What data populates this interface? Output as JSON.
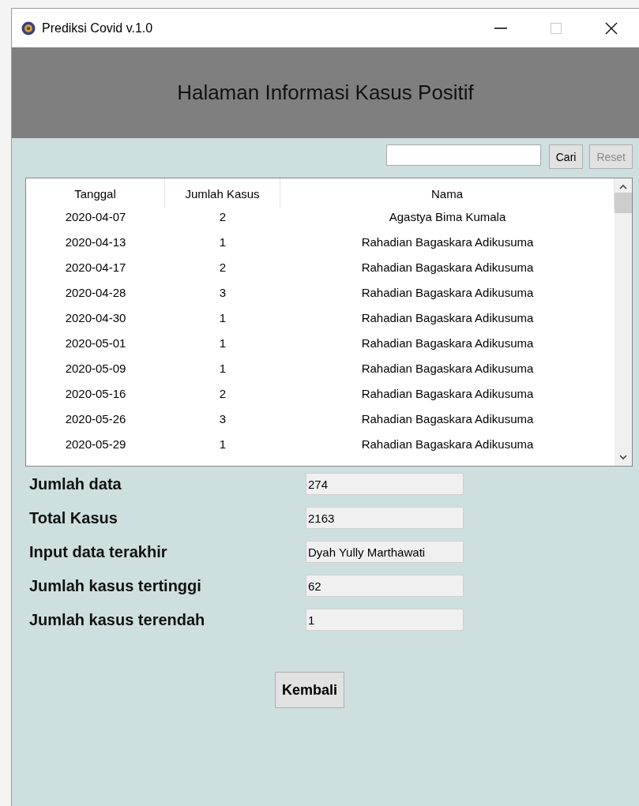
{
  "window": {
    "title": "Prediksi Covid v.1.0",
    "maximize_disabled": true
  },
  "header": {
    "title": "Halaman Informasi Kasus Positif"
  },
  "search": {
    "buttons": [
      {
        "label": "Cari",
        "disabled": false
      },
      {
        "label": "Reset",
        "disabled": true
      }
    ]
  },
  "table": {
    "columns": [
      "Tanggal",
      "Jumlah Kasus",
      "Nama"
    ],
    "rows": [
      [
        "2020-04-07",
        "2",
        "Agastya Bima Kumala"
      ],
      [
        "2020-04-13",
        "1",
        "Rahadian Bagaskara Adikusuma"
      ],
      [
        "2020-04-17",
        "2",
        "Rahadian Bagaskara Adikusuma"
      ],
      [
        "2020-04-28",
        "3",
        "Rahadian Bagaskara Adikusuma"
      ],
      [
        "2020-04-30",
        "1",
        "Rahadian Bagaskara Adikusuma"
      ],
      [
        "2020-05-01",
        "1",
        "Rahadian Bagaskara Adikusuma"
      ],
      [
        "2020-05-09",
        "1",
        "Rahadian Bagaskara Adikusuma"
      ],
      [
        "2020-05-16",
        "2",
        "Rahadian Bagaskara Adikusuma"
      ],
      [
        "2020-05-26",
        "3",
        "Rahadian Bagaskara Adikusuma"
      ],
      [
        "2020-05-29",
        "1",
        "Rahadian Bagaskara Adikusuma"
      ]
    ]
  },
  "summary": [
    {
      "label": "Jumlah data",
      "value": "274"
    },
    {
      "label": "Total Kasus",
      "value": "2163"
    },
    {
      "label": "Input data terakhir",
      "value": "Dyah Yully Marthawati"
    },
    {
      "label": "Jumlah kasus tertinggi",
      "value": "62"
    },
    {
      "label": "Jumlah kasus terendah",
      "value": "1"
    }
  ],
  "back_button": {
    "label": "Kembali"
  }
}
